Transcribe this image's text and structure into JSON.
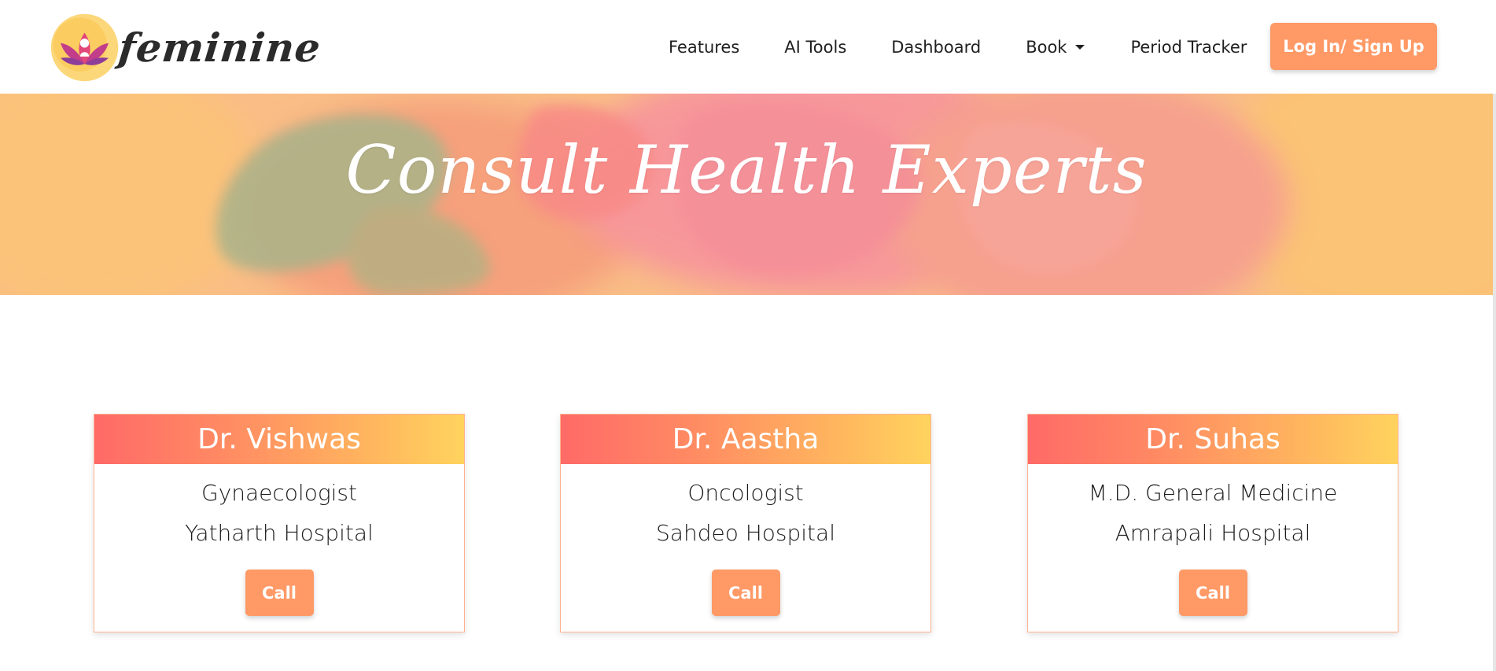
{
  "brand": {
    "name": "feminine",
    "logo_icon": "lotus-woman-logo"
  },
  "nav": {
    "items": [
      {
        "label": "Features"
      },
      {
        "label": "AI Tools"
      },
      {
        "label": "Dashboard"
      },
      {
        "label": "Book",
        "icon": "caret-down-icon"
      },
      {
        "label": "Period Tracker"
      }
    ],
    "login_label": "Log In/ Sign Up"
  },
  "hero": {
    "title": "Consult Health Experts"
  },
  "doctors": [
    {
      "name": "Dr. Vishwas",
      "specialty": "Gynaecologist",
      "hospital": "Yatharth Hospital",
      "call_label": "Call"
    },
    {
      "name": "Dr. Aastha",
      "specialty": "Oncologist",
      "hospital": "Sahdeo Hospital",
      "call_label": "Call"
    },
    {
      "name": "Dr. Suhas",
      "specialty": "M.D. General Medicine",
      "hospital": "Amrapali Hospital",
      "call_label": "Call"
    }
  ],
  "colors": {
    "accent": "#ff9966",
    "card_gradient_start": "#ff6a67",
    "card_gradient_end": "#ffd35e",
    "card_border": "#ffb391"
  }
}
